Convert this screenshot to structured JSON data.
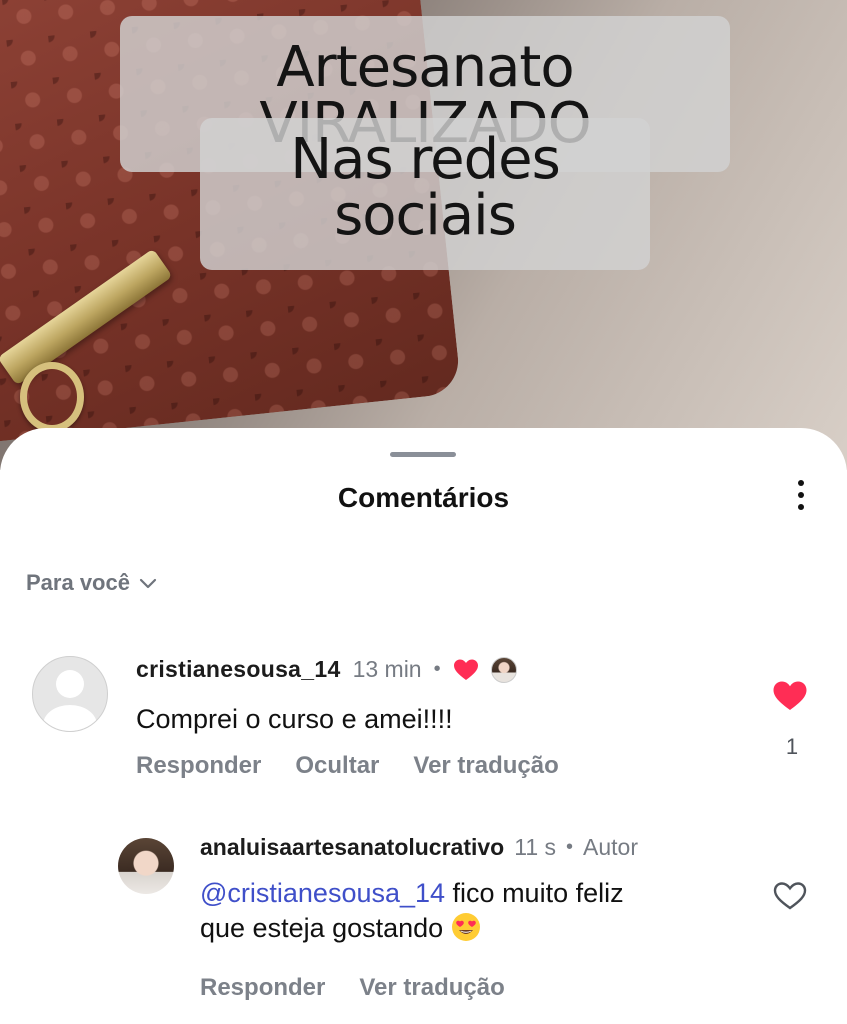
{
  "video": {
    "caption_line1": "Artesanato VIRALIZADO",
    "caption_line2": "Nas redes sociais"
  },
  "sheet": {
    "title": "Comentários",
    "filter_label": "Para você",
    "menu_icon": "more-vertical-icon"
  },
  "comments": [
    {
      "username": "cristianesousa_14",
      "time": "13 min",
      "separator": "•",
      "creator_liked": true,
      "text": "Comprei o curso e amei!!!!",
      "actions": [
        "Responder",
        "Ocultar",
        "Ver tradução"
      ],
      "likes": "1",
      "liked": true
    },
    {
      "username": "analuisaartesanatolucrativo",
      "time": "11 s",
      "separator": "•",
      "badge": "Autor",
      "mention": "@cristianesousa_14",
      "text_line1": " fico muito feliz",
      "text_line2": "que esteja gostando",
      "emoji": "heart-eyes-emoji",
      "actions": [
        "Responder",
        "Ver tradução"
      ],
      "liked": false
    }
  ],
  "colors": {
    "like_red": "#ff2d55",
    "mention_blue": "#3f4fc9",
    "muted_text": "#7c8189"
  }
}
